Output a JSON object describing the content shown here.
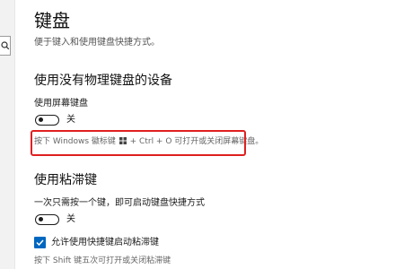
{
  "page": {
    "title": "键盘",
    "subtitle": "便于键入和使用键盘快捷方式。"
  },
  "on_screen_keyboard_section": {
    "heading": "使用没有物理键盘的设备",
    "setting_label": "使用屏幕键盘",
    "toggle_state_label": "关",
    "toggle_on": false,
    "hint_before_icon": "按下 Windows 徽标键",
    "hint_icon": "windows-logo-icon",
    "hint_after_icon": "+ Ctrl + O 可打开或关闭屏幕键盘。",
    "highlight_color": "#e02020"
  },
  "sticky_keys_section": {
    "heading": "使用粘滞键",
    "setting_label": "一次只需按一个键，即可启动键盘快捷方式",
    "toggle_state_label": "关",
    "toggle_on": false,
    "checkbox_label": "允许使用快捷键启动粘滞键",
    "checkbox_checked": true,
    "hint": "按下 Shift 键五次可打开或关闭粘滞键"
  },
  "colors": {
    "accent": "#0067c0",
    "highlight": "#e02020"
  }
}
